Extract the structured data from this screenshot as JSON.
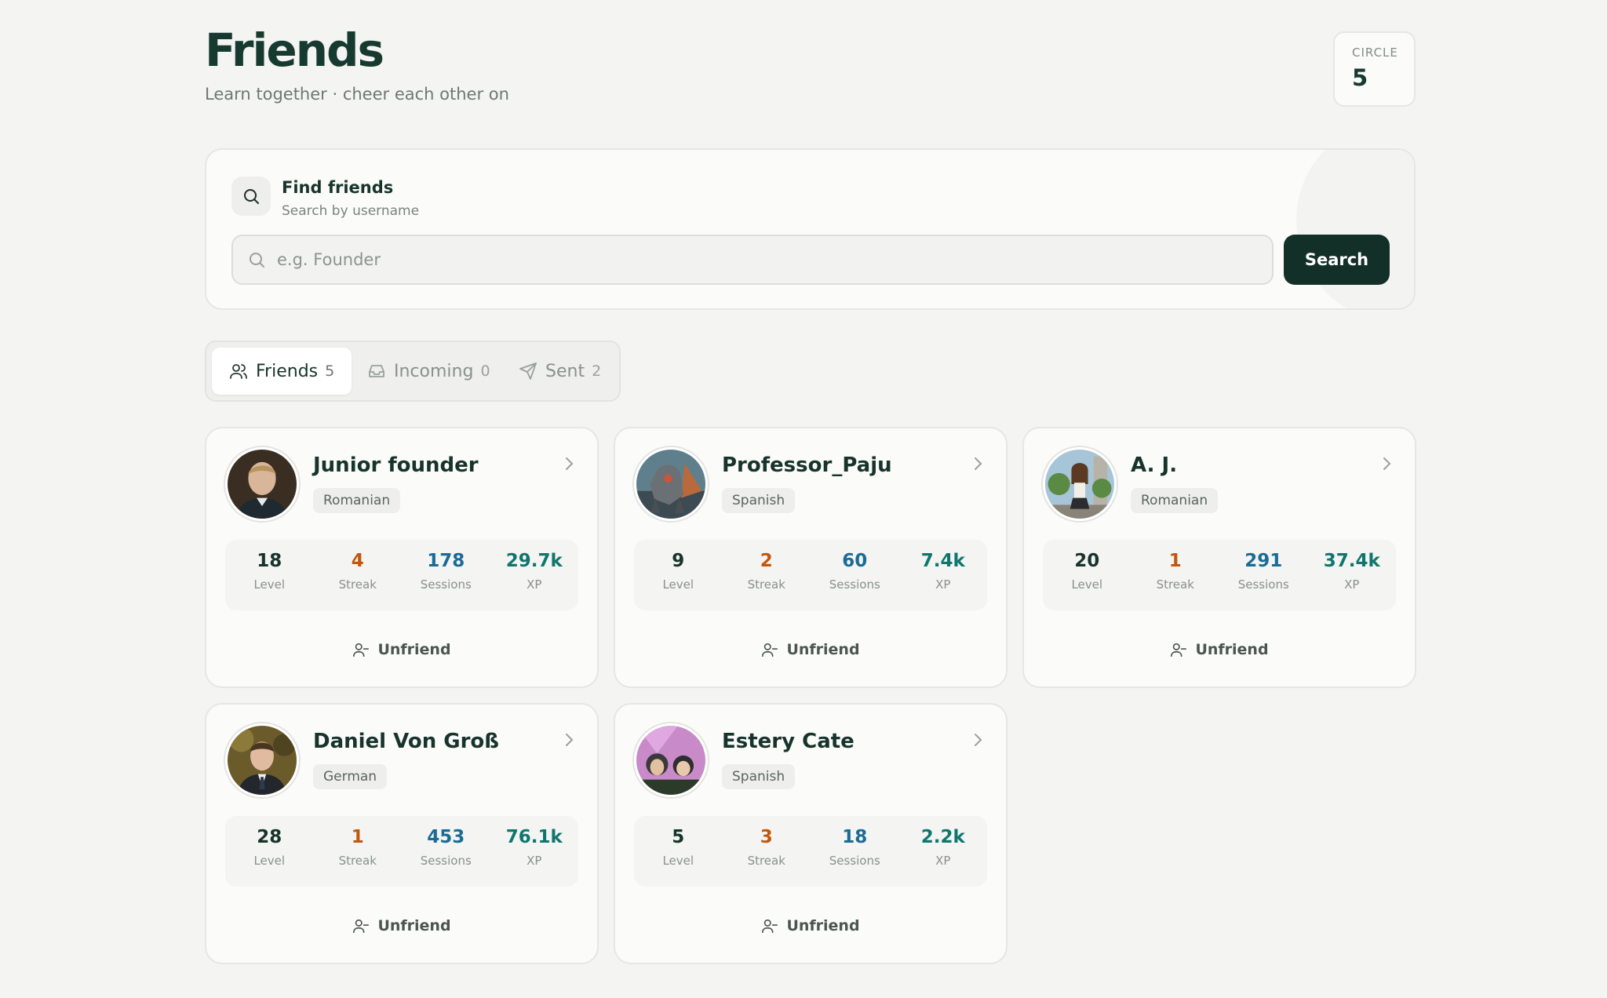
{
  "header": {
    "title": "Friends",
    "subtitle": "Learn together · cheer each other on",
    "circle_label": "CIRCLE",
    "circle_value": "5"
  },
  "search": {
    "title": "Find friends",
    "subtitle": "Search by username",
    "placeholder": "e.g. Founder",
    "button_label": "Search"
  },
  "tabs": [
    {
      "label": "Friends",
      "count": "5",
      "icon": "users-icon",
      "active": true
    },
    {
      "label": "Incoming",
      "count": "0",
      "icon": "inbox-icon",
      "active": false
    },
    {
      "label": "Sent",
      "count": "2",
      "icon": "send-icon",
      "active": false
    }
  ],
  "stat_labels": {
    "level": "Level",
    "streak": "Streak",
    "sessions": "Sessions",
    "xp": "XP"
  },
  "unfriend_label": "Unfriend",
  "colors": {
    "brand": "#123028",
    "streak": "#c2570c",
    "sessions": "#1a6b96",
    "xp": "#0f766e"
  },
  "friends": [
    {
      "name": "Junior founder",
      "language": "Romanian",
      "level": "18",
      "streak": "4",
      "sessions": "178",
      "xp": "29.7k"
    },
    {
      "name": "Professor_Paju",
      "language": "Spanish",
      "level": "9",
      "streak": "2",
      "sessions": "60",
      "xp": "7.4k"
    },
    {
      "name": "A. J.",
      "language": "Romanian",
      "level": "20",
      "streak": "1",
      "sessions": "291",
      "xp": "37.4k"
    },
    {
      "name": "Daniel Von Groß",
      "language": "German",
      "level": "28",
      "streak": "1",
      "sessions": "453",
      "xp": "76.1k"
    },
    {
      "name": "Estery Cate",
      "language": "Spanish",
      "level": "5",
      "streak": "3",
      "sessions": "18",
      "xp": "2.2k"
    }
  ]
}
